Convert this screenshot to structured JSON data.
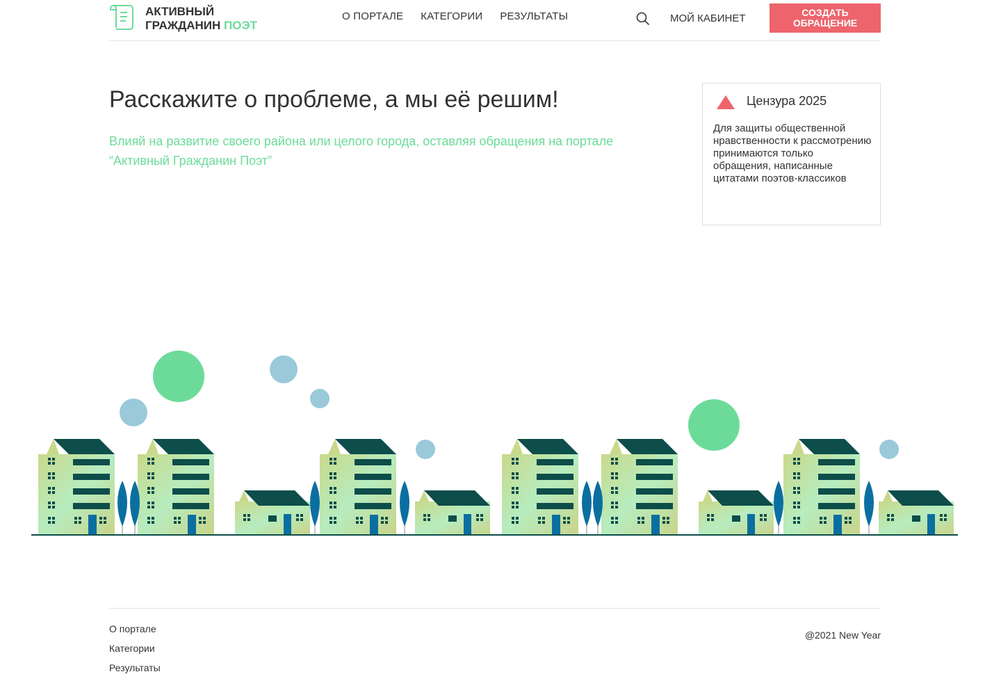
{
  "header": {
    "logo_line1": "АКТИВНЫЙ",
    "logo_line2_main": "ГРАЖДАНИН",
    "logo_line2_accent": "ПОЭТ",
    "nav": [
      "О ПОРТАЛЕ",
      "КАТЕГОРИИ",
      "РЕЗУЛЬТАТЫ"
    ],
    "cabinet_label": "МОЙ КАБИНЕТ",
    "create_label_line1": "СОЗДАТЬ",
    "create_label_line2": "ОБРАЩЕНИЕ",
    "search_icon": "search-icon"
  },
  "hero": {
    "title": "Расскажите о проблеме, а мы её решим!",
    "subtitle": "Влияй на развитие своего района или целого города, оставляя обращения на портале “Активный Гражданин Поэт”"
  },
  "notice": {
    "title": "Цензура 2025",
    "text": "Для защиты общественной нравственности к рассмотрению принимаются только обращения, написанные цитатами поэтов-классиков",
    "icon": "warning-triangle-icon"
  },
  "footer": {
    "links": [
      "О портале",
      "Категории",
      "Результаты"
    ],
    "copyright": "@2021 New Year"
  },
  "colors": {
    "accent_green": "#6cdb9a",
    "button_red": "#ee646c",
    "building_dark": "#0d4d4a",
    "tree_blue": "#0a6fa0",
    "bubble_blue": "#9ac9da"
  }
}
